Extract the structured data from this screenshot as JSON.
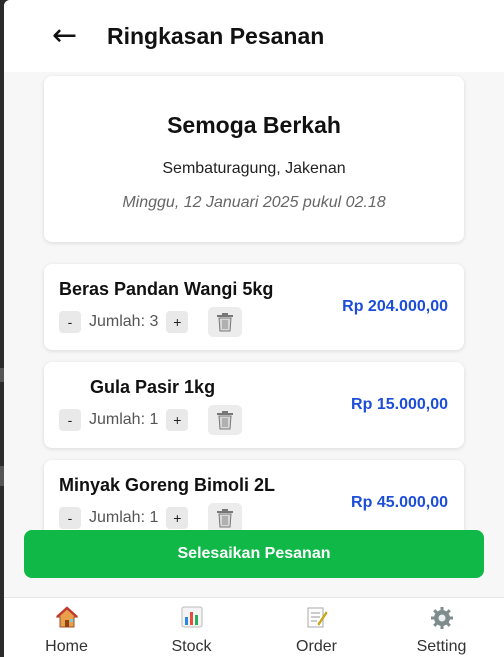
{
  "header": {
    "back_icon": "←",
    "title": "Ringkasan Pesanan"
  },
  "store": {
    "name": "Semoga Berkah",
    "location": "Sembaturagung, Jakenan",
    "datetime": "Minggu, 12 Januari 2025 pukul 02.18"
  },
  "items": [
    {
      "name": "Beras Pandan Wangi 5kg",
      "quantity_label": "Jumlah: 3",
      "quantity": 3,
      "price": "Rp 204.000,00"
    },
    {
      "name": "Gula Pasir 1kg",
      "quantity_label": "Jumlah: 1",
      "quantity": 1,
      "price": "Rp 15.000,00"
    },
    {
      "name": "Minyak Goreng Bimoli 2L",
      "quantity_label": "Jumlah: 1",
      "quantity": 1,
      "price": "Rp 45.000,00"
    }
  ],
  "controls": {
    "minus_label": "-",
    "plus_label": "+",
    "delete_icon": "trash-icon"
  },
  "finish_button": "Selesaikan Pesanan",
  "nav": [
    {
      "label": "Home",
      "icon": "house-icon"
    },
    {
      "label": "Stock",
      "icon": "bar-chart-icon"
    },
    {
      "label": "Order",
      "icon": "memo-icon"
    },
    {
      "label": "Setting",
      "icon": "gear-icon"
    }
  ],
  "colors": {
    "accent_green": "#10b947",
    "price_blue": "#1d4ed8"
  }
}
